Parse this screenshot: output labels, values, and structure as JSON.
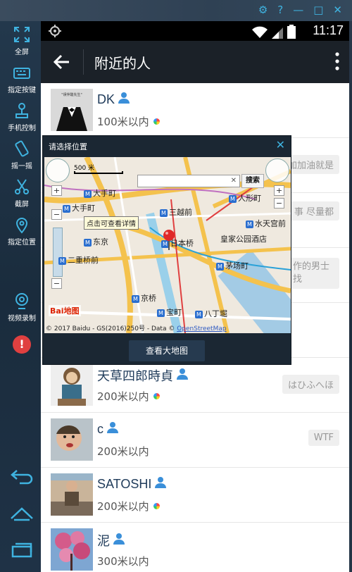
{
  "window": {
    "controls": [
      "settings-icon",
      "help-icon",
      "minimize-icon",
      "maximize-icon",
      "close-icon"
    ]
  },
  "sidebar": {
    "items": [
      {
        "label": "全屏",
        "icon": "fullscreen-icon"
      },
      {
        "label": "指定按键",
        "icon": "keyboard-icon"
      },
      {
        "label": "手机控制",
        "icon": "phone-control-icon"
      },
      {
        "label": "摇一摇",
        "icon": "shake-icon"
      },
      {
        "label": "截屏",
        "icon": "scissors-icon"
      },
      {
        "label": "指定位置",
        "icon": "location-pin-icon"
      },
      {
        "label": "视频录制",
        "icon": "camera-icon"
      }
    ],
    "bottom_icons": [
      "back-icon",
      "home-icon",
      "recent-apps-icon"
    ]
  },
  "status_bar": {
    "time": "11:17"
  },
  "app_bar": {
    "title": "附近的人"
  },
  "people": [
    {
      "name": "DK",
      "distance": "100米以内",
      "signature": ""
    },
    {
      "name": "",
      "distance": "",
      "signature": "加加油就是"
    },
    {
      "name": "",
      "distance": "",
      "signature": "事 尽量都"
    },
    {
      "name": "",
      "distance": "",
      "signature": "作的男士\n找"
    },
    {
      "name": "",
      "distance": "",
      "signature": ""
    },
    {
      "name": "天草四郎時貞",
      "distance": "200米以内",
      "signature": "はひふへほ"
    },
    {
      "name": "c",
      "distance": "200米以内",
      "signature": "WTF"
    },
    {
      "name": "SATOSHI",
      "distance": "200米以内",
      "signature": ""
    },
    {
      "name": "泥",
      "distance": "300米以内",
      "signature": ""
    }
  ],
  "map_dialog": {
    "title": "请选择位置",
    "search_button": "搜索",
    "search_placeholder": "",
    "scale": "500 米",
    "tooltip": "点击可查看详情",
    "copyright": "© 2017 Baidu - GS(2016)250号 - Data ©",
    "copyright_link": "OpenStreetMap",
    "logo_text": "Bai地图",
    "view_map_button": "查看大地图",
    "labels": [
      {
        "text": "大手町"
      },
      {
        "text": "大手町"
      },
      {
        "text": "三越前"
      },
      {
        "text": "人形町"
      },
      {
        "text": "水天宫前"
      },
      {
        "text": "皇家公园酒店"
      },
      {
        "text": "日本桥"
      },
      {
        "text": "东京"
      },
      {
        "text": "二重桥前"
      },
      {
        "text": "茅场町"
      },
      {
        "text": "京桥"
      },
      {
        "text": "宝町"
      },
      {
        "text": "八丁堀"
      }
    ]
  }
}
